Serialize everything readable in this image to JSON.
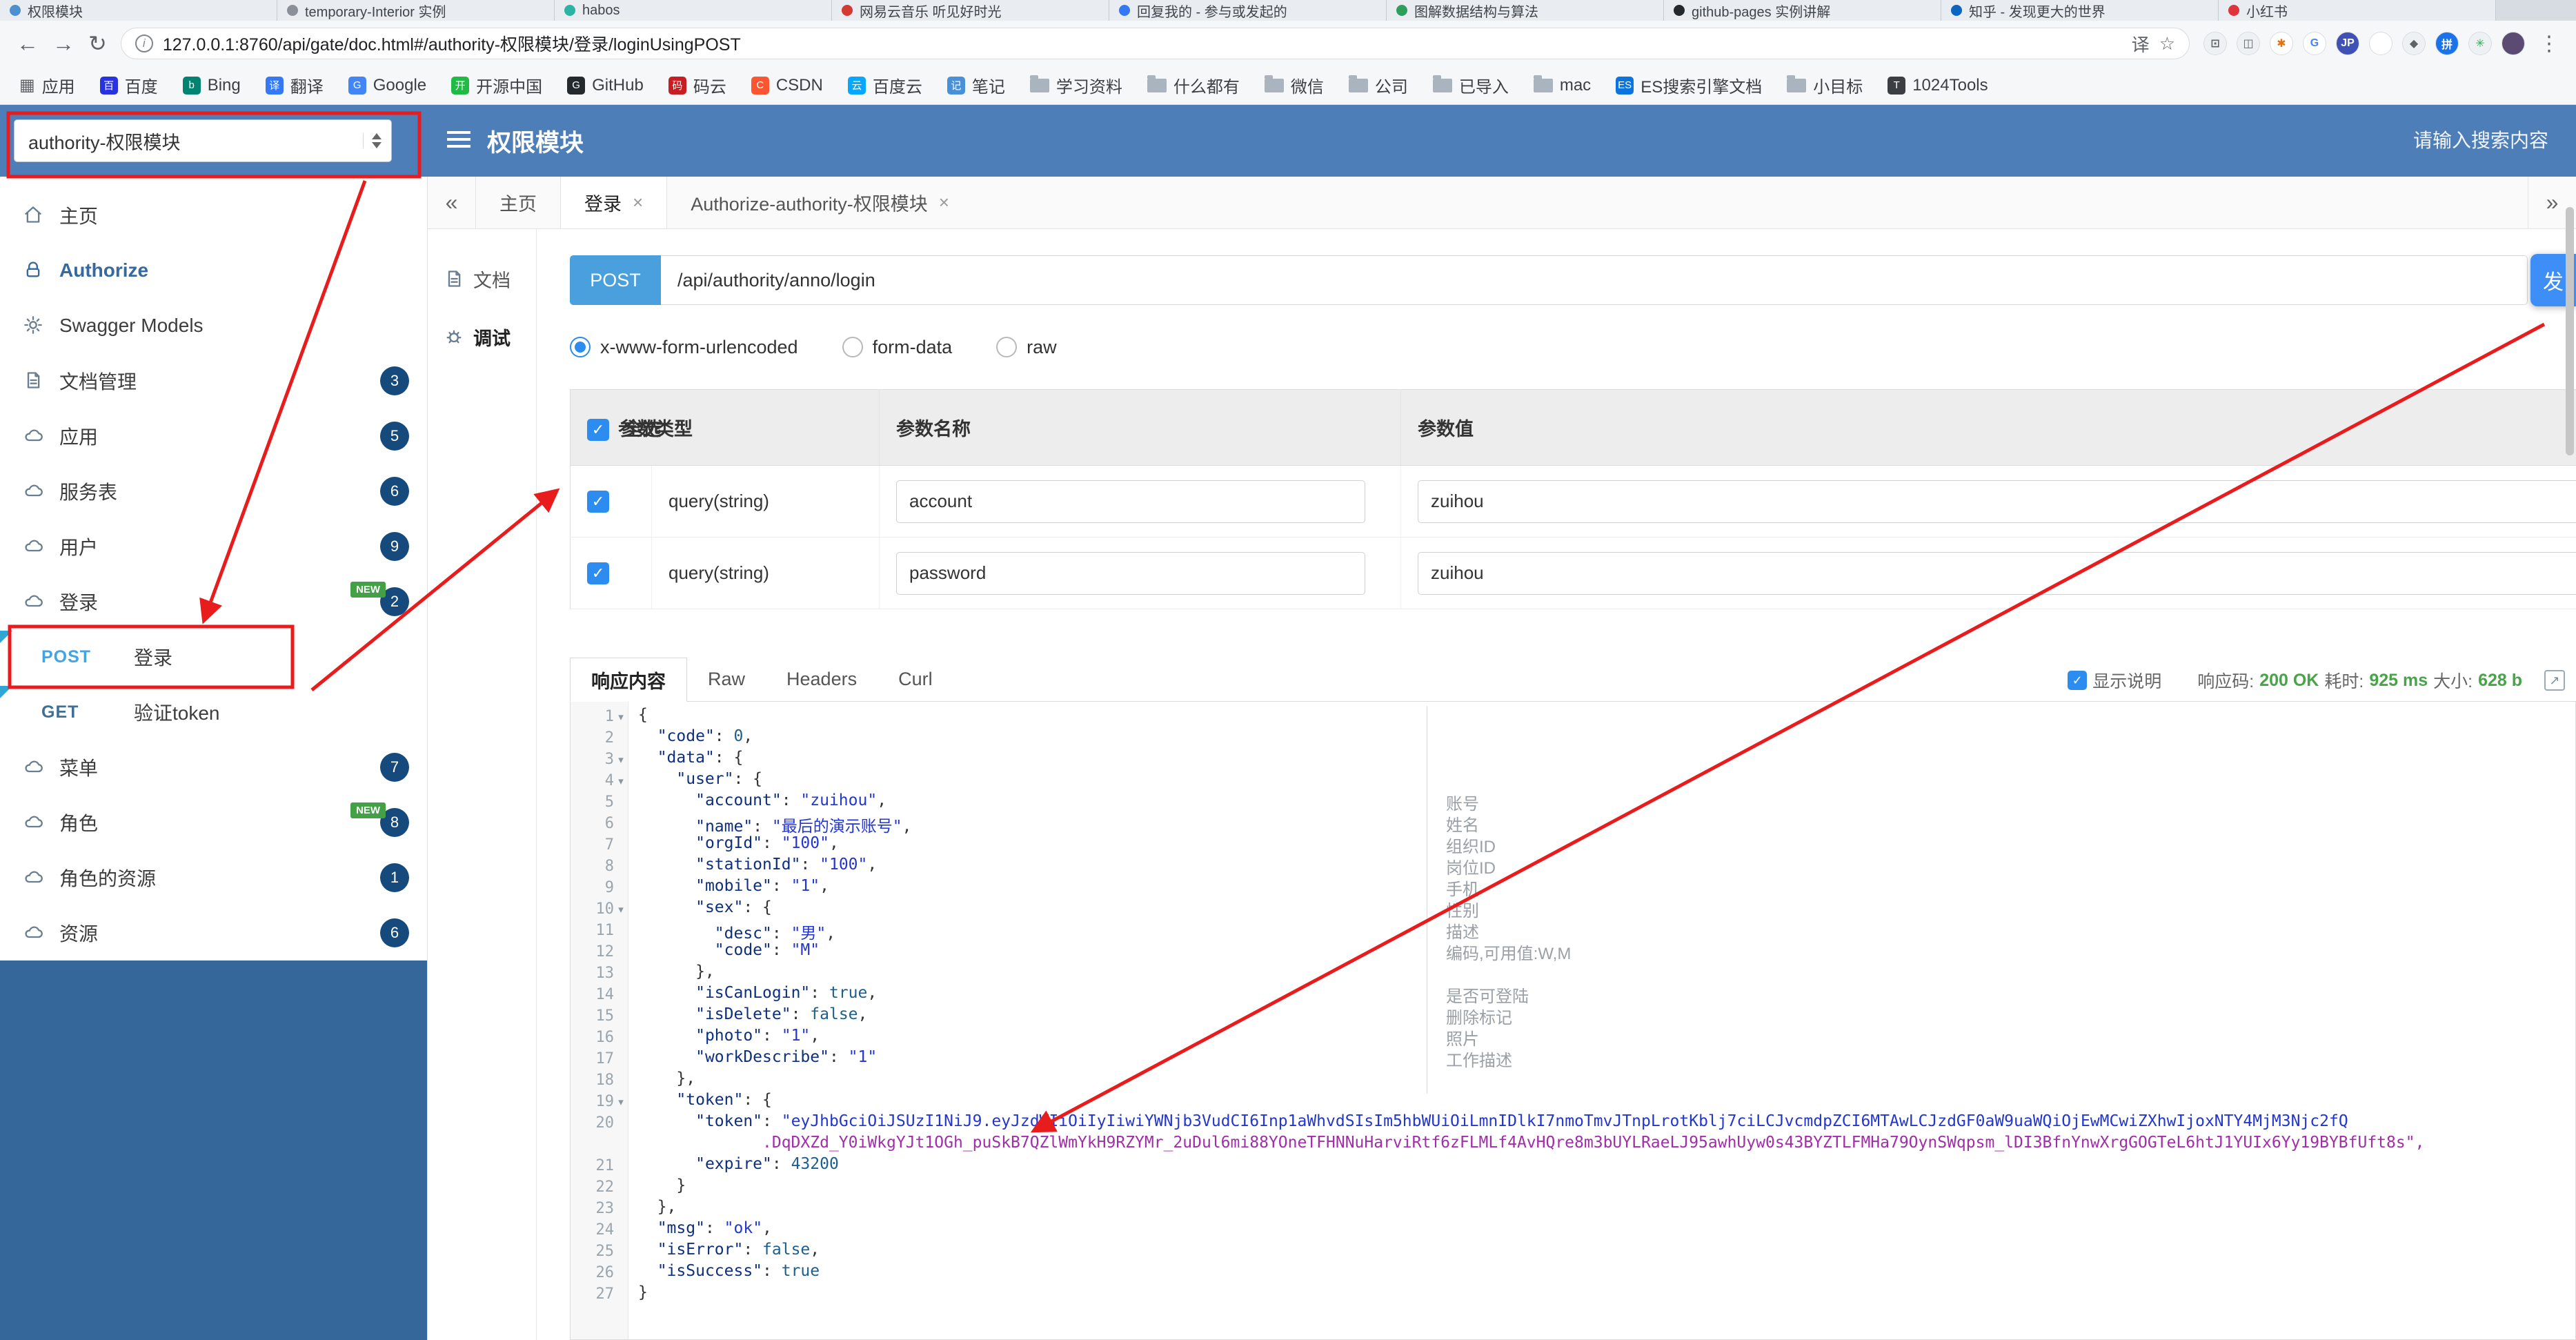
{
  "browser": {
    "tabs": [
      {
        "title": "权限模块",
        "color": "#4e8fd1"
      },
      {
        "title": "temporary-Interior 实例",
        "color": "#8a8f98"
      },
      {
        "title": "habos",
        "color": "#2bb3a3"
      },
      {
        "title": "网易云音乐 听见好时光",
        "color": "#d33a31"
      },
      {
        "title": "回复我的 - 参与或发起的",
        "color": "#3478f6"
      },
      {
        "title": "图解数据结构与算法",
        "color": "#2e9e5b"
      },
      {
        "title": "github-pages 实例讲解",
        "color": "#24292e"
      },
      {
        "title": "知乎 - 发现更大的世界",
        "color": "#0a66c2"
      },
      {
        "title": "小红书",
        "color": "#e0343c"
      }
    ],
    "address": {
      "url": "127.0.0.1:8760/api/gate/doc.html#/authority-权限模块/登录/loginUsingPOST",
      "icons": [
        {
          "name": "screenshot-icon",
          "glyph": "⊡",
          "bg": "#eef1f4",
          "fg": "#5f6368"
        },
        {
          "name": "reader-icon",
          "glyph": "◫",
          "bg": "#eef1f4",
          "fg": "#5f6368"
        },
        {
          "name": "colorpick-icon",
          "glyph": "✱",
          "bg": "#ffffff",
          "fg": "#e8710a"
        },
        {
          "name": "google-icon",
          "glyph": "G",
          "bg": "#ffffff",
          "fg": "#4285f4"
        },
        {
          "name": "jp-icon",
          "glyph": "JP",
          "bg": "#3f51b5",
          "fg": "#ffffff"
        },
        {
          "name": "circle-icon",
          "glyph": "",
          "bg": "#ffffff",
          "fg": "#999999"
        },
        {
          "name": "shield-icon",
          "glyph": "◆",
          "bg": "#eef1f4",
          "fg": "#5f6368"
        },
        {
          "name": "pin-icon",
          "glyph": "拼",
          "bg": "#1a73e8",
          "fg": "#ffffff"
        },
        {
          "name": "tool-icon",
          "glyph": "✳",
          "bg": "#eef1f4",
          "fg": "#34a853"
        },
        {
          "name": "avatar",
          "glyph": "",
          "bg": "#5b4b72",
          "fg": "#ffffff"
        }
      ]
    },
    "bookmarks": [
      {
        "label": "应用",
        "icon": "grid"
      },
      {
        "label": "百度",
        "icon": "letter",
        "glyph": "百",
        "color": "#2932e1"
      },
      {
        "label": "Bing",
        "icon": "letter",
        "glyph": "b",
        "color": "#008373"
      },
      {
        "label": "翻译",
        "icon": "letter",
        "glyph": "译",
        "color": "#3478f6"
      },
      {
        "label": "Google",
        "icon": "letter",
        "glyph": "G",
        "color": "#4285f4"
      },
      {
        "label": "开源中国",
        "icon": "letter",
        "glyph": "开",
        "color": "#21ba45"
      },
      {
        "label": "GitHub",
        "icon": "letter",
        "glyph": "G",
        "color": "#24292e"
      },
      {
        "label": "码云",
        "icon": "letter",
        "glyph": "码",
        "color": "#c71d23"
      },
      {
        "label": "CSDN",
        "icon": "letter",
        "glyph": "C",
        "color": "#fc5531"
      },
      {
        "label": "百度云",
        "icon": "letter",
        "glyph": "云",
        "color": "#06a7ff"
      },
      {
        "label": "笔记",
        "icon": "letter",
        "glyph": "记",
        "color": "#4a90d9"
      },
      {
        "label": "学习资料",
        "icon": "folder"
      },
      {
        "label": "什么都有",
        "icon": "folder"
      },
      {
        "label": "微信",
        "icon": "folder"
      },
      {
        "label": "公司",
        "icon": "folder"
      },
      {
        "label": "已导入",
        "icon": "folder"
      },
      {
        "label": "mac",
        "icon": "folder"
      },
      {
        "label": "ES搜索引擎文档",
        "icon": "letter",
        "glyph": "ES",
        "color": "#0b74de"
      },
      {
        "label": "小目标",
        "icon": "folder"
      },
      {
        "label": "1024Tools",
        "icon": "letter",
        "glyph": "T",
        "color": "#3b3f44"
      }
    ]
  },
  "header": {
    "module_select": "authority-权限模块",
    "title": "权限模块",
    "search_placeholder": "请输入搜索内容"
  },
  "sidebar": {
    "new_label": "NEW",
    "items": [
      {
        "label": "主页",
        "icon": "home-icon"
      },
      {
        "label": "Authorize",
        "icon": "lock-icon",
        "accent": true
      },
      {
        "label": "Swagger Models",
        "icon": "gear-icon"
      },
      {
        "label": "文档管理",
        "icon": "doc-icon",
        "badge": "3"
      },
      {
        "label": "应用",
        "icon": "cloud-icon",
        "badge": "5"
      },
      {
        "label": "服务表",
        "icon": "cloud-icon",
        "badge": "6"
      },
      {
        "label": "用户",
        "icon": "cloud-icon",
        "badge": "9"
      },
      {
        "label": "登录",
        "icon": "cloud-icon",
        "badge": "2",
        "isNew": true
      },
      {
        "label": "登录",
        "method": "POST",
        "indent": true,
        "selected": true
      },
      {
        "label": "验证token",
        "method": "GET",
        "indent": true
      },
      {
        "label": "菜单",
        "icon": "cloud-icon",
        "badge": "7"
      },
      {
        "label": "角色",
        "icon": "cloud-icon",
        "badge": "8",
        "isNew": true
      },
      {
        "label": "角色的资源",
        "icon": "cloud-icon",
        "badge": "1"
      },
      {
        "label": "资源",
        "icon": "cloud-icon",
        "badge": "6"
      }
    ]
  },
  "doc_tabs": {
    "back": "«",
    "forward": "»",
    "tabs": [
      {
        "label": "主页"
      },
      {
        "label": "登录",
        "closable": true,
        "active": true
      },
      {
        "label": "Authorize-authority-权限模块",
        "closable": true
      }
    ]
  },
  "subnav": {
    "items": [
      {
        "label": "文档",
        "icon": "doc-icon"
      },
      {
        "label": "调试",
        "icon": "debug-icon",
        "active": true
      }
    ]
  },
  "request": {
    "method": "POST",
    "url": "/api/authority/anno/login",
    "send_label": "发",
    "content_types": [
      {
        "label": "x-www-form-urlencoded",
        "selected": true
      },
      {
        "label": "form-data"
      },
      {
        "label": "raw"
      }
    ]
  },
  "params": {
    "headers": [
      "全选",
      "参数类型",
      "参数名称",
      "参数值"
    ],
    "rows": [
      {
        "checked": true,
        "type": "query(string)",
        "name": "account",
        "value": "zuihou"
      },
      {
        "checked": true,
        "type": "query(string)",
        "name": "password",
        "value": "zuihou"
      }
    ]
  },
  "response": {
    "tabs": [
      "响应内容",
      "Raw",
      "Headers",
      "Curl"
    ],
    "active_tab": "响应内容",
    "show_desc_label": "显示说明",
    "meta": {
      "code_label": "响应码:",
      "code": "200 OK",
      "time_label": "耗时:",
      "time": "925 ms",
      "size_label": "大小:",
      "size": "628 b"
    },
    "code_lines": [
      {
        "n": "1",
        "t": "{"
      },
      {
        "n": "2",
        "t": "  \"code\": 0,"
      },
      {
        "n": "3",
        "t": "  \"data\": {"
      },
      {
        "n": "4",
        "t": "    \"user\": {"
      },
      {
        "n": "5",
        "t": "      \"account\": \"zuihou\","
      },
      {
        "n": "6",
        "t": "      \"name\": \"最后的演示账号\","
      },
      {
        "n": "7",
        "t": "      \"orgId\": \"100\","
      },
      {
        "n": "8",
        "t": "      \"stationId\": \"100\","
      },
      {
        "n": "9",
        "t": "      \"mobile\": \"1\","
      },
      {
        "n": "10",
        "t": "      \"sex\": {"
      },
      {
        "n": "11",
        "t": "        \"desc\": \"男\","
      },
      {
        "n": "12",
        "t": "        \"code\": \"M\""
      },
      {
        "n": "13",
        "t": "      },"
      },
      {
        "n": "14",
        "t": "      \"isCanLogin\": true,"
      },
      {
        "n": "15",
        "t": "      \"isDelete\": false,"
      },
      {
        "n": "16",
        "t": "      \"photo\": \"1\","
      },
      {
        "n": "17",
        "t": "      \"workDescribe\": \"1\""
      },
      {
        "n": "18",
        "t": "    },"
      },
      {
        "n": "19",
        "t": "    \"token\": {"
      },
      {
        "n": "20",
        "t": "      \"token\": \"eyJhbGciOiJSUzI1NiJ9.eyJzdWIiOiIyIiwiYWNjb3VudCI6Inp1aWhvdSIsIm5hbWUiOiLmnIDlkI7nmoTmvJTnpLrotKblj7ciLCJvcmdpZCI6MTAwLCJzdGF0aW9uaWQiOjEwMCwiZXhwIjoxNTY4MjM3Njc2fQ",
        "open": true
      },
      {
        "n": "",
        "t": "             .DqDXZd_Y0iWkgYJt1OGh_puSkB7QZlWmYkH9RZYMr_2uDul6mi88YOneTFHNNuHarviRtf6zFLMLf4AvHQre8m3bUYLRaeLJ95awhUyw0s43BYZTLFMHa79OynSWqpsm_lDI3BfnYnwXrgGOGTeL6htJ1YUIx6Yy19BYBfUft8s\",",
        "cont": true
      },
      {
        "n": "21",
        "t": "      \"expire\": 43200"
      },
      {
        "n": "22",
        "t": "    }"
      },
      {
        "n": "23",
        "t": "  },"
      },
      {
        "n": "24",
        "t": "  \"msg\": \"ok\","
      },
      {
        "n": "25",
        "t": "  \"isError\": false,"
      },
      {
        "n": "26",
        "t": "  \"isSuccess\": true"
      },
      {
        "n": "27",
        "t": "}"
      }
    ],
    "annotations": [
      {
        "line": 5,
        "text": "账号"
      },
      {
        "line": 6,
        "text": "姓名"
      },
      {
        "line": 7,
        "text": "组织ID"
      },
      {
        "line": 8,
        "text": "岗位ID"
      },
      {
        "line": 9,
        "text": "手机"
      },
      {
        "line": 10,
        "text": "性别"
      },
      {
        "line": 11,
        "text": "描述"
      },
      {
        "line": 12,
        "text": "编码,可用值:W,M"
      },
      {
        "line": 14,
        "text": "是否可登陆"
      },
      {
        "line": 15,
        "text": "删除标记"
      },
      {
        "line": 16,
        "text": "照片"
      },
      {
        "line": 17,
        "text": "工作描述"
      }
    ]
  }
}
